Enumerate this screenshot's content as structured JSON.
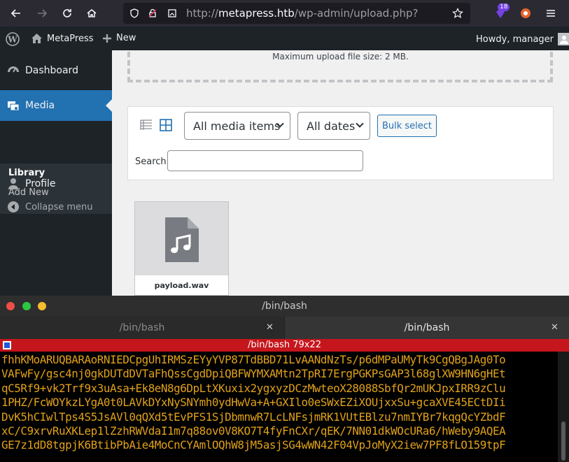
{
  "browser": {
    "url_prefix": "http://",
    "url_host": "metapress.htb",
    "url_path": "/wp-admin/upload.php?",
    "extension_badge": "18"
  },
  "adminbar": {
    "site_name": "MetaPress",
    "new_label": "New",
    "howdy": "Howdy, manager"
  },
  "sidebar": {
    "dashboard": "Dashboard",
    "media": "Media",
    "library": "Library",
    "add_new": "Add New",
    "profile": "Profile",
    "collapse": "Collapse menu"
  },
  "content": {
    "max_upload": "Maximum upload file size: 2 MB.",
    "filter_media": "All media items",
    "filter_dates": "All dates",
    "bulk_select": "Bulk select",
    "search_label": "Search",
    "attachment_name": "payload.wav"
  },
  "terminal": {
    "window_title": "/bin/bash",
    "tab1": "/bin/bash",
    "tab2": "/bin/bash",
    "pane_title": "/bin/bash 79x22",
    "lines": [
      "fhhKMoARUQBARAoRNIEDCpgUhIRMSzEYyYVP87TdBBD71LvAANdNzTs/p6dMPaUMyTk9CgQBgJAg0To",
      "VAFwFy/gsc4nj0gkDUTdDVTaFhQssCgdDpiQBFWYMXAMtn2TpRI7ErgPGKPsGAP3l68glXW9HN6gHEt",
      "qC5Rf9+vk2Trf9x3uAsa+Ek8eN8g6DpLtXKuxix2ygxyzDCzMwteoX28088SbfQr2mUKJpxIRR9zClu",
      "1PHZ/FcWOYkzLYgA0t0LAVkDYxNySNYmh0ydHwVa+A+GXIlo0eSWxEZiXOUjxxSu+gcaXVE45ECtDIi",
      "DvK5hCIwlTps4S5JsAVl0qQXd5tEvPFS1SjDbmnwR7LcLNFsjmRK1VUtEBlzu7nmIYBr7kqgQcYZbdF",
      "xC/C9xrvRuXKLep1lZzhRWVdaI1m7q88ov0V8KO7T4fyFnCXr/qEK/7NN01dkWOcURa6/hWeby9AQEA",
      "GE7z1dD8tgpjK6BtibPbAie4MoCnCYAmlOQhW8jM5asjSG4wWN42F04VpJoMyX2iew7PF8fLO159tpF"
    ]
  }
}
